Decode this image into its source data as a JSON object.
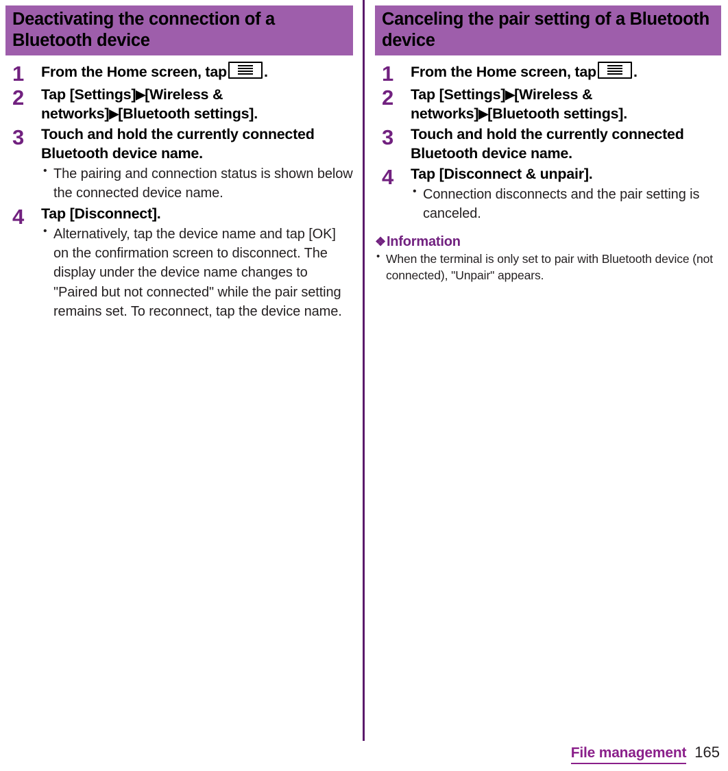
{
  "page": {
    "number": "165",
    "chapter": "File management",
    "accent_band_color": "#9E5EAB",
    "accent_number_color": "#71217F",
    "divider_color": "#5B1A6B",
    "footer_link_color": "#8A1F8A"
  },
  "columns": [
    {
      "heading": "Deactivating the connection of a Bluetooth device",
      "steps": [
        {
          "number": "1",
          "title_prefix": "From the Home screen, tap",
          "icon": "menu-key-icon",
          "title_suffix": ".",
          "notes": []
        },
        {
          "number": "2",
          "title_parts": [
            "Tap [Settings]",
            "▶",
            "[Wireless & networks]",
            "▶",
            "[Bluetooth settings]."
          ],
          "notes": []
        },
        {
          "number": "3",
          "title": "Touch and hold the currently connected Bluetooth device name.",
          "notes": [
            "The pairing and connection status is shown below the connected device name."
          ]
        },
        {
          "number": "4",
          "title": "Tap [Disconnect].",
          "notes": [
            "Alternatively, tap the device name and tap [OK] on the confirmation screen to disconnect. The display under the device name changes to \"Paired but not connected\" while the pair setting remains set. To reconnect, tap the device name."
          ]
        }
      ],
      "information": null
    },
    {
      "heading": "Canceling the pair setting of a Bluetooth device",
      "steps": [
        {
          "number": "1",
          "title_prefix": "From the Home screen, tap",
          "icon": "menu-key-icon",
          "title_suffix": ".",
          "notes": []
        },
        {
          "number": "2",
          "title_parts": [
            "Tap [Settings]",
            "▶",
            "[Wireless & networks]",
            "▶",
            "[Bluetooth settings]."
          ],
          "notes": []
        },
        {
          "number": "3",
          "title": "Touch and hold the currently connected Bluetooth device name.",
          "notes": []
        },
        {
          "number": "4",
          "title": "Tap [Disconnect & unpair].",
          "notes": [
            "Connection disconnects and the pair setting is canceled."
          ]
        }
      ],
      "information": {
        "marker": "❖",
        "heading": "Information",
        "items": [
          "When the terminal is only set to pair with Bluetooth device (not connected), \"Unpair\" appears."
        ]
      }
    }
  ]
}
